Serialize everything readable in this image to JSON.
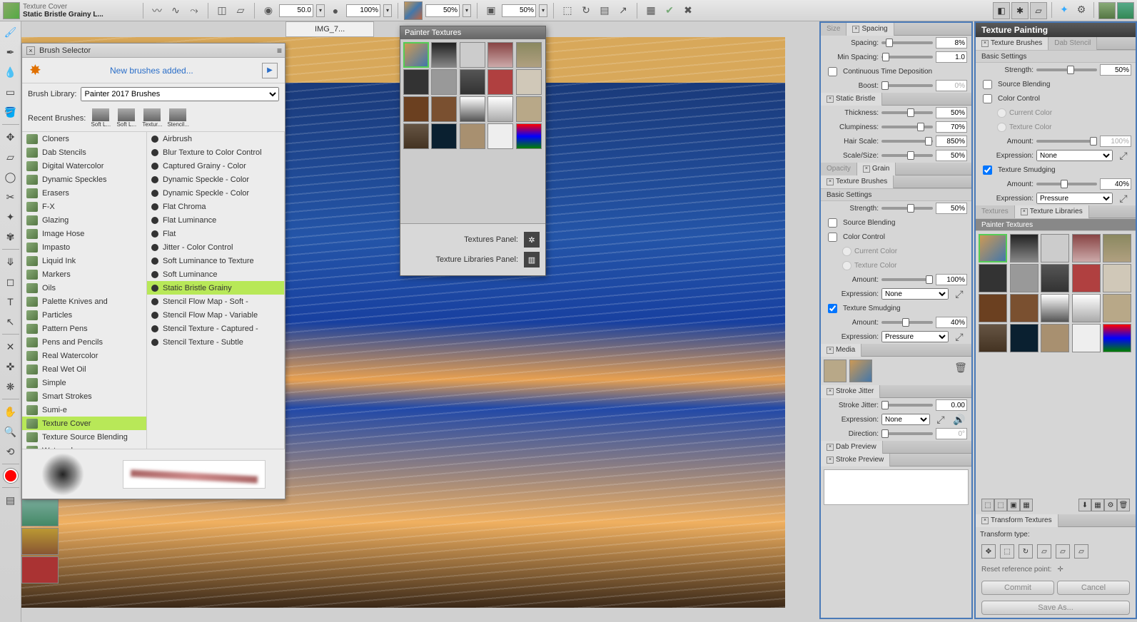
{
  "toolbar": {
    "brush_category": "Texture Cover",
    "brush_name": "Static Bristle Grainy L...",
    "size": "50.0",
    "opacity": "100%",
    "grain": "50%",
    "resat": "50%",
    "recent_labels": [
      "Soft L...",
      "Soft L...",
      "Textur...",
      "Stencil..."
    ]
  },
  "doc_tab": "IMG_7...",
  "brush_panel": {
    "title": "Brush Selector",
    "new_msg": "New brushes added...",
    "lib_label": "Brush Library:",
    "lib_value": "Painter 2017 Brushes",
    "recent_label": "Recent Brushes:",
    "categories": [
      "Cloners",
      "Dab Stencils",
      "Digital Watercolor",
      "Dynamic Speckles",
      "Erasers",
      "F-X",
      "Glazing",
      "Image Hose",
      "Impasto",
      "Liquid Ink",
      "Markers",
      "Oils",
      "Palette Knives and",
      "Particles",
      "Pattern Pens",
      "Pens and Pencils",
      "Real Watercolor",
      "Real Wet Oil",
      "Simple",
      "Smart Strokes",
      "Sumi-e",
      "Texture Cover",
      "Texture Source Blending",
      "Watercolor"
    ],
    "cat_selected": "Texture Cover",
    "variants": [
      "Airbrush",
      "Blur Texture to Color Control",
      "Captured Grainy - Color",
      "Dynamic Speckle - Color",
      "Dynamic Speckle - Color",
      "Flat Chroma",
      "Flat Luminance",
      "Flat",
      "Jitter - Color Control",
      "Soft Luminance to Texture",
      "Soft Luminance",
      "Static Bristle Grainy",
      "Stencil Flow Map - Soft -",
      "Stencil Flow Map - Variable",
      "Stencil Texture - Captured -",
      "Stencil Texture - Subtle"
    ],
    "var_selected": "Static Bristle Grainy"
  },
  "tex_popup": {
    "title": "Painter Textures",
    "panel_label": "Textures Panel:",
    "lib_label": "Texture Libraries Panel:"
  },
  "right": {
    "size_tab": "Size",
    "spacing_tab": "Spacing",
    "spacing": {
      "spacing": "8%",
      "min_spacing": "1.0",
      "ctd": "Continuous Time Deposition",
      "boost": "0%"
    },
    "static_bristle_tab": "Static Bristle",
    "bristle": {
      "thickness": "50%",
      "clumpiness": "70%",
      "hair_scale": "850%",
      "scale_size": "50%"
    },
    "opacity_tab": "Opacity",
    "grain_tab": "Grain",
    "tex_brushes_tab": "Texture Brushes",
    "basic": "Basic Settings",
    "strength": "50%",
    "source_blending": "Source Blending",
    "color_control": "Color Control",
    "current_color": "Current Color",
    "texture_color": "Texture Color",
    "amount": "100%",
    "expression": "Expression:",
    "expr_none": "None",
    "tex_smudging": "Texture Smudging",
    "smudge_amount": "40%",
    "expr_pressure": "Pressure",
    "media_tab": "Media",
    "jitter_tab": "Stroke Jitter",
    "jitter_val": "0.00",
    "direction": "0°",
    "dab_preview": "Dab Preview",
    "stroke_preview": "Stroke Preview",
    "labels": {
      "spacing": "Spacing:",
      "min_spacing": "Min Spacing:",
      "boost": "Boost:",
      "thickness": "Thickness:",
      "clumpiness": "Clumpiness:",
      "hair_scale": "Hair Scale:",
      "scale_size": "Scale/Size:",
      "strength": "Strength:",
      "amount": "Amount:",
      "stroke_jitter": "Stroke Jitter:",
      "direction": "Direction:"
    }
  },
  "tpp": {
    "title": "Texture Painting",
    "tab_brushes": "Texture Brushes",
    "tab_stencil": "Dab Stencil",
    "basic": "Basic Settings",
    "strength": "50%",
    "source_blending": "Source Blending",
    "color_control": "Color Control",
    "current_color": "Current Color",
    "texture_color": "Texture Color",
    "amount": "100%",
    "expr_none": "None",
    "tex_smudging": "Texture Smudging",
    "smudge_amount": "40%",
    "expr_pressure": "Pressure",
    "textures_tab": "Textures",
    "tex_lib_tab": "Texture Libraries",
    "painter_textures": "Painter Textures",
    "transform_tab": "Transform Textures",
    "transform_type": "Transform type:",
    "reset_ref": "Reset reference point:",
    "commit": "Commit",
    "cancel": "Cancel",
    "save_as": "Save As..."
  }
}
